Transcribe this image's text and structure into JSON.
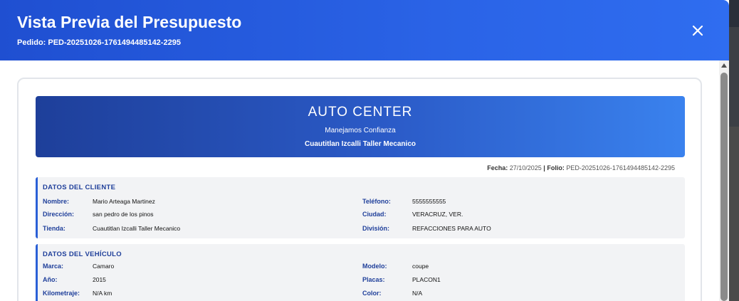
{
  "modal": {
    "title": "Vista Previa del Presupuesto",
    "subtitle": "Pedido: PED-20251026-1761494485142-2295",
    "close_icon": "close-icon"
  },
  "banner": {
    "title": "AUTO CENTER",
    "slogan": "Manejamos Confianza",
    "branch": "Cuautitlan Izcalli Taller Mecanico"
  },
  "meta": {
    "fecha_label": "Fecha:",
    "fecha_value": "27/10/2025",
    "separator": "|",
    "folio_label": "Folio:",
    "folio_value": "PED-20251026-1761494485142-2295"
  },
  "client": {
    "title": "DATOS DEL CLIENTE",
    "nombre_label": "Nombre:",
    "nombre_value": "Mario Arteaga Martinez",
    "telefono_label": "Teléfono:",
    "telefono_value": "5555555555",
    "direccion_label": "Dirección:",
    "direccion_value": "san pedro de los pinos",
    "ciudad_label": "Ciudad:",
    "ciudad_value": "VERACRUZ, VER.",
    "tienda_label": "Tienda:",
    "tienda_value": "Cuautitlan Izcalli Taller Mecanico",
    "division_label": "División:",
    "division_value": "REFACCIONES PARA AUTO"
  },
  "vehicle": {
    "title": "DATOS DEL VEHÍCULO",
    "marca_label": "Marca:",
    "marca_value": "Camaro",
    "modelo_label": "Modelo:",
    "modelo_value": "coupe",
    "anio_label": "Año:",
    "anio_value": "2015",
    "placas_label": "Placas:",
    "placas_value": "PLACON1",
    "kilometraje_label": "Kilometraje:",
    "kilometraje_value": "N/A km",
    "color_label": "Color:",
    "color_value": "N/A"
  },
  "colors": {
    "header_blue": "#2a63e6",
    "label_blue": "#1f3f9a",
    "section_bg": "#f2f3f5"
  }
}
